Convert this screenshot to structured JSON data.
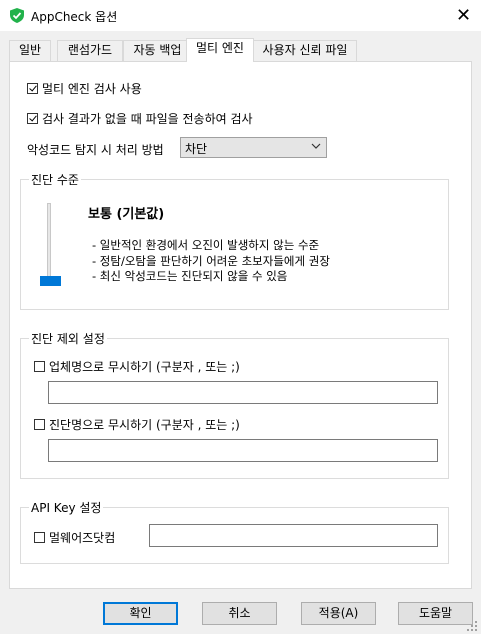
{
  "window": {
    "title": "AppCheck 옵션",
    "icon": "shield-check-icon",
    "close_label": "✕"
  },
  "tabs": [
    {
      "label": "일반"
    },
    {
      "label": "랜섬가드"
    },
    {
      "label": "자동 백업"
    },
    {
      "label": "멀티 엔진",
      "active": true
    },
    {
      "label": "사용자 신뢰 파일"
    }
  ],
  "options": {
    "use_multi_engine": {
      "label": "멀티 엔진 검사 사용",
      "checked": true
    },
    "upload_when_no_result": {
      "label": "검사 결과가 없을 때 파일을 전송하여 검사",
      "checked": true
    },
    "detect_action_label": "악성코드 탐지 시 처리 방법",
    "detect_action_value": "차단"
  },
  "level": {
    "group_title": "진단 수준",
    "current": "보통 (기본값)",
    "desc": [
      "- 일반적인 환경에서 오진이 발생하지 않는 수준",
      "- 정탐/오탐을 판단하기 어려운 초보자들에게 권장",
      "- 최신 악성코드는 진단되지 않을 수 있음"
    ]
  },
  "exclude": {
    "group_title": "진단 제외 설정",
    "vendor": {
      "label": "업체명으로 무시하기 (구분자 , 또는 ;)",
      "checked": false,
      "value": ""
    },
    "detection": {
      "label": "진단명으로 무시하기 (구분자 , 또는 ;)",
      "checked": false,
      "value": ""
    }
  },
  "apikey": {
    "group_title": "API Key 설정",
    "malwares": {
      "label": "멀웨어즈닷컴",
      "checked": false,
      "value": ""
    }
  },
  "buttons": {
    "ok": "확인",
    "cancel": "취소",
    "apply": "적용(A)",
    "help": "도움말"
  },
  "colors": {
    "accent": "#0078d7",
    "icon_green": "#21b24b"
  }
}
